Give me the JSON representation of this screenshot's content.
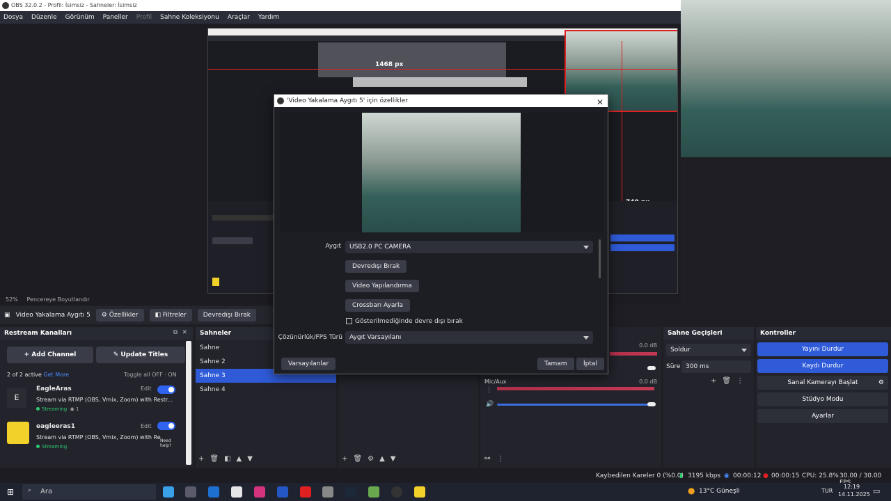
{
  "window": {
    "title": "OBS 32.0.2 - Profil: İsimsiz - Sahneler: İsimsiz"
  },
  "menu": [
    "Dosya",
    "Düzenle",
    "Görünüm",
    "Paneller",
    "Profil",
    "Sahne Koleksiyonu",
    "Araçlar",
    "Yardım"
  ],
  "preview": {
    "px_horizontal": "1468 px",
    "px_vertical": "740 px",
    "zoom": "52%",
    "fit_label": "Pencereye Boyutlandır"
  },
  "source_toolbar": {
    "source_name": "Video Yakalama Aygıtı 5",
    "properties": "Özellikler",
    "filters": "Filtreler",
    "deactivate": "Devredışı Bırak"
  },
  "restream": {
    "title": "Restream Kanalları",
    "add_channel": "Add Channel",
    "update_titles": "Update Titles",
    "active_count": "2 of 2 active",
    "get_more": "Get More",
    "toggle_all": "Toggle all",
    "off": "OFF",
    "on": "ON",
    "channels": [
      {
        "name": "EagleAras",
        "desc": "Stream via RTMP (OBS, Vmix, Zoom) with Restr...",
        "status": "Streaming",
        "viewers": "1",
        "edit": "Edit"
      },
      {
        "name": "eagleeras1",
        "desc": "Stream via RTMP (OBS, Vmix, Zoom) with Re",
        "status": "Streaming",
        "edit": "Edit"
      }
    ],
    "need_help": "Need help?"
  },
  "scenes": {
    "title": "Sahneler",
    "items": [
      "Sahne",
      "Sahne 2",
      "Sahne 3",
      "Sahne 4"
    ],
    "active": "Sahne 3"
  },
  "mixer": {
    "db1": "0.0 dB",
    "label2": "Mic/Aux",
    "db2": "0.0 dB"
  },
  "transitions": {
    "title": "Sahne Geçişleri",
    "selected": "Soldur",
    "duration_label": "Süre",
    "duration": "300 ms"
  },
  "controls": {
    "title": "Kontroller",
    "buttons": [
      "Yayını Durdur",
      "Kaydı Durdur",
      "Sanal Kamerayı Başlat",
      "Stüdyo Modu",
      "Ayarlar"
    ]
  },
  "status": {
    "dropped": "Kaybedilen Kareler 0 (%0.0)",
    "bitrate": "3195 kbps",
    "stream_time": "00:00:12",
    "rec_time": "00:00:15",
    "cpu": "CPU: 25.8%",
    "fps": "30.00 / 30.00 FPS"
  },
  "taskbar": {
    "search": "Ara",
    "weather": "13°C Güneşli",
    "lang": "TUR",
    "time": "12:19",
    "date": "14.11.2025"
  },
  "dialog": {
    "title": "'Video Yakalama Aygıtı 5' için özellikler",
    "device_label": "Aygıt",
    "device_value": "USB2.0 PC CAMERA",
    "deactivate": "Devredışı Bırak",
    "video_config": "Video Yapılandırma",
    "crossbar": "Crossbarı Ayarla",
    "checkbox_label": "Gösterilmediğinde devre dışı bırak",
    "res_label": "Çözünürlük/FPS Türü",
    "res_value": "Aygıt Varsayılanı",
    "defaults": "Varsayılanlar",
    "ok": "Tamam",
    "cancel": "İptal"
  },
  "colors": {
    "accent_blue": "#2f5bd8",
    "bg_dark": "#1e1e24",
    "selection_red": "#e02020"
  }
}
